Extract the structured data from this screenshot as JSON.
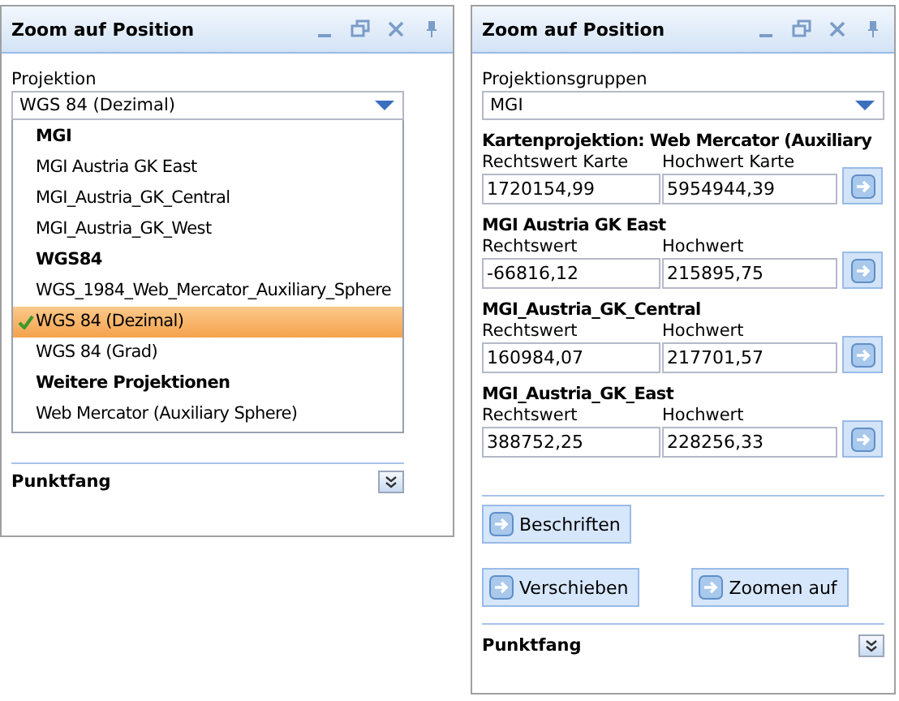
{
  "left_panel": {
    "title": "Zoom auf Position",
    "projection": {
      "label": "Projektion",
      "value": "WGS 84 (Dezimal)"
    },
    "dropdown": {
      "items": [
        {
          "kind": "group",
          "text": "MGI"
        },
        {
          "kind": "option",
          "text": "MGI Austria GK East",
          "selected": false
        },
        {
          "kind": "option",
          "text": "MGI_Austria_GK_Central",
          "selected": false
        },
        {
          "kind": "option",
          "text": "MGI_Austria_GK_West",
          "selected": false
        },
        {
          "kind": "group",
          "text": "WGS84"
        },
        {
          "kind": "option",
          "text": "WGS_1984_Web_Mercator_Auxiliary_Sphere",
          "selected": false
        },
        {
          "kind": "option",
          "text": "WGS 84 (Dezimal)",
          "selected": true
        },
        {
          "kind": "option",
          "text": "WGS 84 (Grad)",
          "selected": false
        },
        {
          "kind": "group",
          "text": "Weitere Projektionen"
        },
        {
          "kind": "option",
          "text": "Web Mercator (Auxiliary Sphere)",
          "selected": false
        }
      ]
    },
    "punktfang": {
      "label": "Punktfang"
    }
  },
  "right_panel": {
    "title": "Zoom auf Position",
    "group": {
      "label": "Projektionsgruppen",
      "value": "MGI"
    },
    "sections": [
      {
        "title": "Kartenprojektion: Web Mercator (Auxiliary",
        "fields": [
          {
            "label": "Rechtswert Karte",
            "value": "1720154,99"
          },
          {
            "label": "Hochwert Karte",
            "value": "5954944,39"
          }
        ]
      },
      {
        "title": "MGI Austria GK East",
        "fields": [
          {
            "label": "Rechtswert",
            "value": "-66816,12"
          },
          {
            "label": "Hochwert",
            "value": "215895,75"
          }
        ]
      },
      {
        "title": "MGI_Austria_GK_Central",
        "fields": [
          {
            "label": "Rechtswert",
            "value": "160984,07"
          },
          {
            "label": "Hochwert",
            "value": "217701,57"
          }
        ]
      },
      {
        "title": "MGI_Austria_GK_East",
        "fields": [
          {
            "label": "Rechtswert",
            "value": "388752,25"
          },
          {
            "label": "Hochwert",
            "value": "228256,33"
          }
        ]
      }
    ],
    "buttons": [
      [
        "Beschriften"
      ],
      [
        "Verschieben",
        "Zoomen auf"
      ]
    ],
    "punktfang": {
      "label": "Punktfang"
    }
  }
}
